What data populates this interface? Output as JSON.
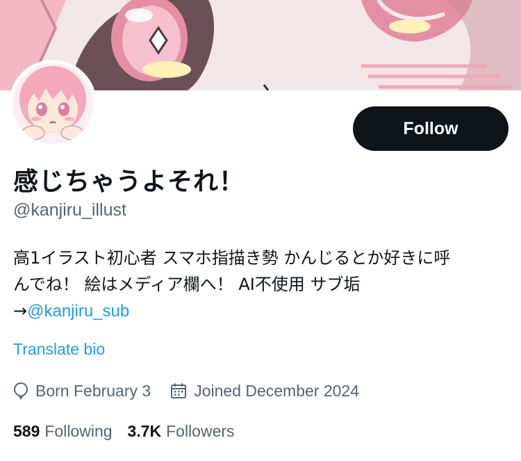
{
  "profile": {
    "display_name": "感じちゃうよそれ！",
    "handle": "@kanjiru_illust",
    "bio_line1": "高1イラスト初心者 スマホ指描き勢 かんじるとか好きに呼",
    "bio_line2": "んでね！ 絵はメディア欄へ！ AI不使用 サブ垢",
    "bio_arrow": "→",
    "bio_mention": "@kanjiru_sub",
    "translate_label": "Translate bio",
    "born": "Born February 3",
    "joined": "Joined December 2024",
    "following_count": "589",
    "following_label": "Following",
    "followers_count": "3.7K",
    "followers_label": "Followers"
  },
  "actions": {
    "follow_label": "Follow"
  },
  "icons": {
    "birthday": "balloon-icon",
    "joined": "calendar-icon"
  },
  "colors": {
    "accent": "#1d9bf0",
    "button_bg": "#0f1419",
    "muted_text": "#536471"
  }
}
